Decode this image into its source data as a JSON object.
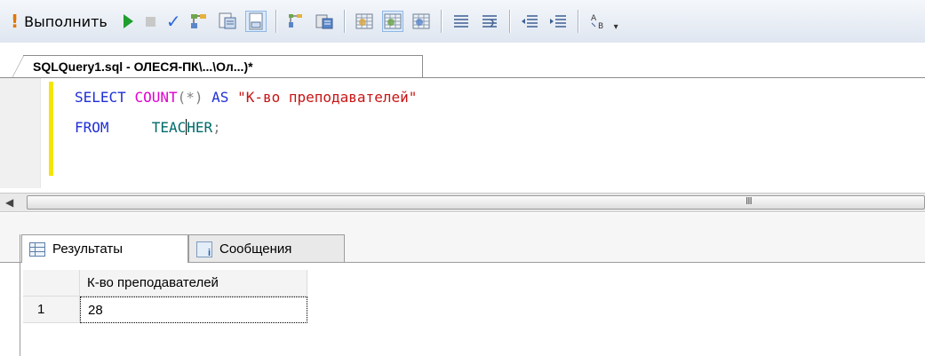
{
  "toolbar": {
    "execute_label": "Выполнить",
    "icons": [
      "execute-icon",
      "play-icon",
      "stop-icon",
      "parse-check-icon",
      "display-plan-icon",
      "query-designer-icon",
      "results-to-grid-icon",
      "include-plan-icon",
      "results-to-text-icon",
      "results-to-file-icon",
      "table-icon-1",
      "table-icon-2",
      "table-icon-3",
      "comment-icon",
      "uncomment-icon",
      "decrease-indent-icon",
      "increase-indent-icon",
      "specify-values-icon"
    ]
  },
  "editor": {
    "tab_title": "SQLQuery1.sql - ОЛЕСЯ-ПК\\...\\Ол...)*",
    "line1": {
      "kw_select": "SELECT",
      "fn_count": "COUNT",
      "op_star": "(*)",
      "kw_as": "AS",
      "alias": "\"К-во преподавателей\""
    },
    "line2": {
      "kw_from": "FROM",
      "table_before_caret": "TEAC",
      "table_after_caret": "HER",
      "semicolon": ";"
    },
    "hscroll_grip": "III"
  },
  "results": {
    "tabs": [
      {
        "label": "Результаты",
        "icon": "grid-icon"
      },
      {
        "label": "Сообщения",
        "icon": "messages-icon"
      }
    ],
    "columns": [
      "К-во преподавателей"
    ],
    "rows": [
      {
        "num": "1",
        "values": [
          "28"
        ]
      }
    ]
  },
  "colors": {
    "keyword": "#1f2fd6",
    "function": "#e000d0",
    "string": "#c81414",
    "identifier": "#006b6b",
    "change_bar": "#f5e500"
  }
}
